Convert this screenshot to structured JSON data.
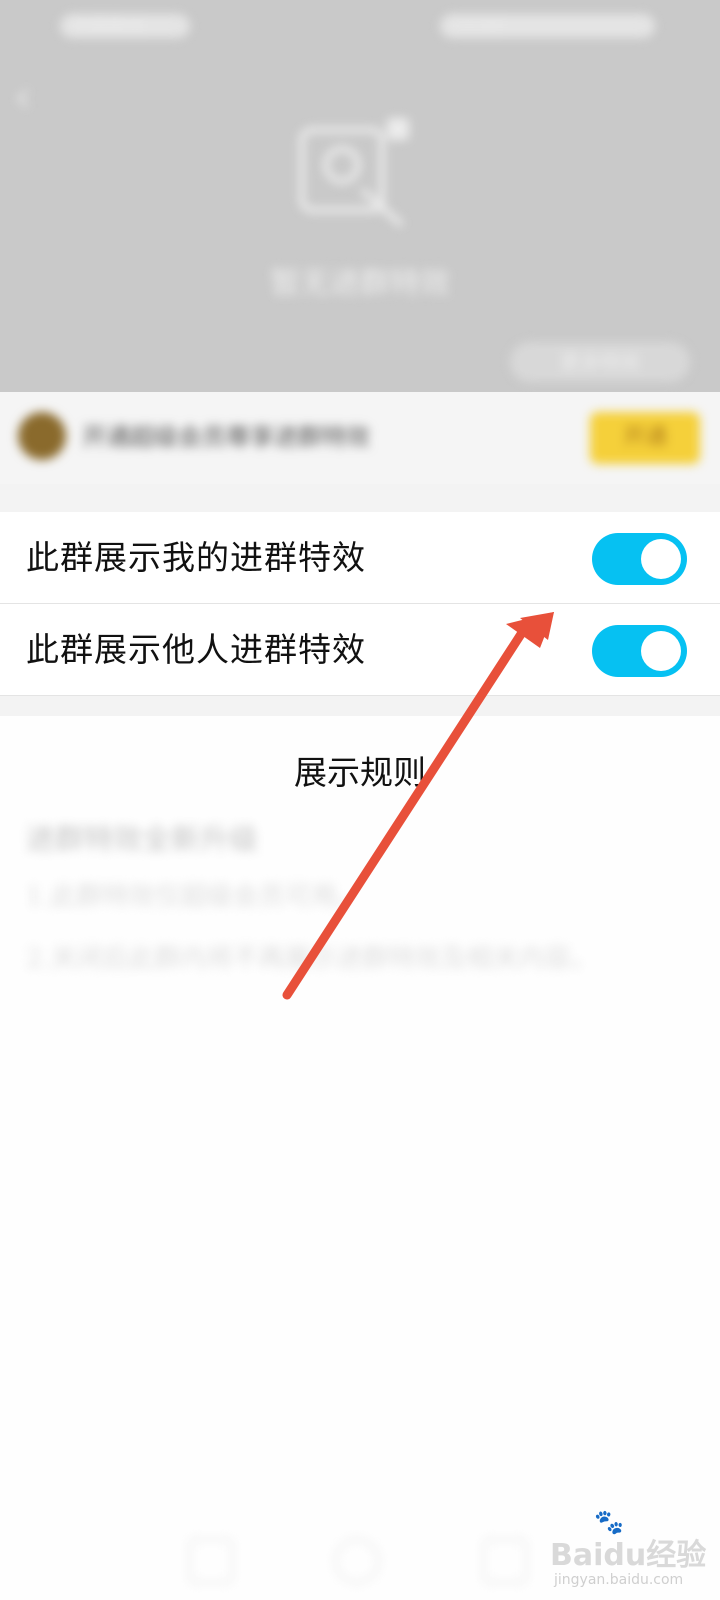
{
  "top_preview": {
    "status_left": "中国移动",
    "status_right": "12:00",
    "back_icon": "back-chevron-icon",
    "effect_icon": "effect-preview-icon",
    "preview_text": "暂无进群特效",
    "preview_button": "更多特效"
  },
  "vip_banner": {
    "text": "开通超级会员尊享进群特效",
    "button": "开通"
  },
  "settings": [
    {
      "label": "此群展示我的进群特效",
      "enabled": true
    },
    {
      "label": "此群展示他人进群特效",
      "enabled": true
    }
  ],
  "rules": {
    "title": "展示规则",
    "subtitle": "进群特效全新升级",
    "lines": [
      "1.此群特效仅超级会员可用。",
      "2.关闭后此群内将不再展示进群特效及相关内容。"
    ]
  },
  "watermark": {
    "main": "Baidu经验",
    "sub": "jingyan.baidu.com"
  },
  "colors": {
    "toggle_on": "#06c1f2",
    "arrow": "#e8503a",
    "vip_button": "#f5d03a"
  }
}
